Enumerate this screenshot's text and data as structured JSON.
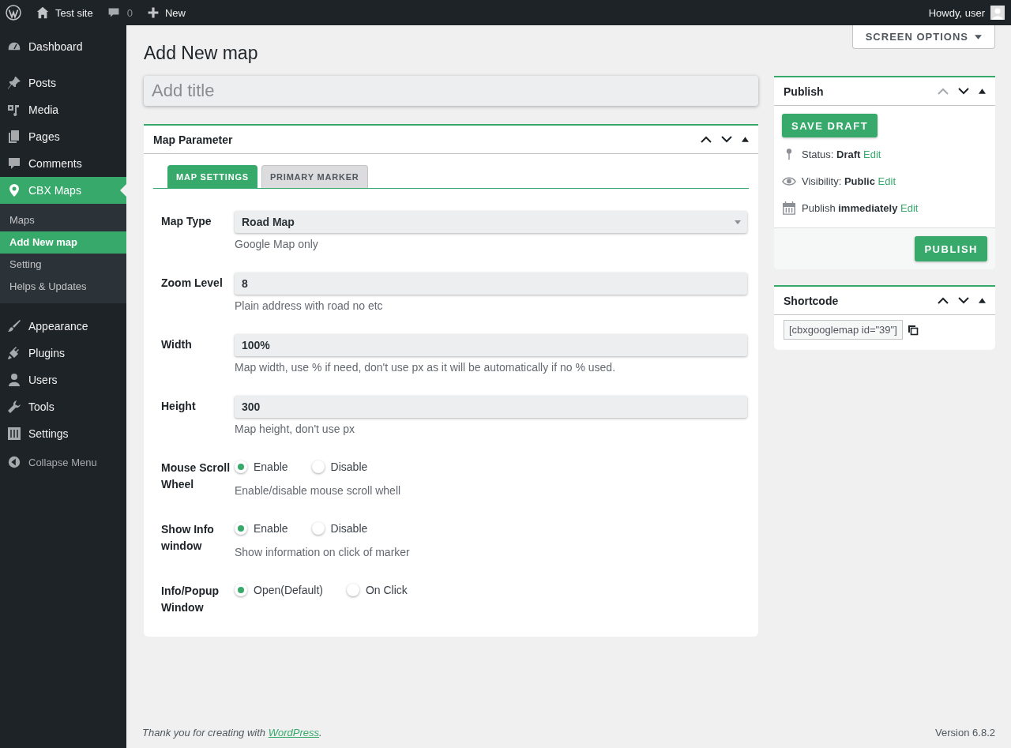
{
  "admin_bar": {
    "site_name": "Test site",
    "comments_count": "0",
    "new_label": "New",
    "greeting": "Howdy, user"
  },
  "sidebar": {
    "sections": [
      {
        "items": [
          {
            "label": "Dashboard",
            "selected": false
          }
        ]
      },
      {
        "items": [
          {
            "label": "Posts",
            "selected": false
          },
          {
            "label": "Media",
            "selected": false
          },
          {
            "label": "Pages",
            "selected": false
          },
          {
            "label": "Comments",
            "selected": false
          },
          {
            "label": "CBX Maps",
            "selected": true,
            "children": [
              {
                "label": "Maps",
                "selected": false
              },
              {
                "label": "Add New map",
                "selected": true
              },
              {
                "label": "Setting",
                "selected": false
              },
              {
                "label": "Helps & Updates",
                "selected": false
              }
            ]
          }
        ]
      },
      {
        "items": [
          {
            "label": "Appearance",
            "selected": false
          },
          {
            "label": "Plugins",
            "selected": false
          },
          {
            "label": "Users",
            "selected": false
          },
          {
            "label": "Tools",
            "selected": false
          },
          {
            "label": "Settings",
            "selected": false
          }
        ]
      }
    ],
    "collapse_label": "Collapse Menu"
  },
  "screen_options": "SCREEN OPTIONS",
  "page_title": "Add New map",
  "title_field": {
    "placeholder": "Add title"
  },
  "map_parameter": {
    "title": "Map Parameter",
    "move_up_disabled": false,
    "tabs": [
      {
        "label": "MAP SETTINGS",
        "selected": true
      },
      {
        "label": "PRIMARY MARKER",
        "selected": false
      }
    ],
    "fields": [
      {
        "kind": "select",
        "label": "Map Type",
        "value": "Road Map",
        "description": "Google Map only"
      },
      {
        "kind": "text",
        "label": "Zoom Level",
        "value": "8",
        "description": "Plain address with road no etc"
      },
      {
        "kind": "text",
        "label": "Width",
        "value": "100%",
        "description": "Map width, use % if need, don't use px as it will be automatically if no % used."
      },
      {
        "kind": "text",
        "label": "Height",
        "value": "300",
        "description": "Map height, don't use px"
      },
      {
        "kind": "radio",
        "label": "Mouse Scroll Wheel",
        "options": [
          {
            "label": "Enable",
            "selected": true
          },
          {
            "label": "Disable",
            "selected": false
          }
        ],
        "description": "Enable/disable mouse scroll whell"
      },
      {
        "kind": "radio",
        "label": "Show Info window",
        "options": [
          {
            "label": "Enable",
            "selected": true
          },
          {
            "label": "Disable",
            "selected": false
          }
        ],
        "description": "Show information on click of marker"
      },
      {
        "kind": "radio",
        "label": "Info/Popup Window",
        "options": [
          {
            "label": "Open(Default)",
            "selected": true
          },
          {
            "label": "On Click",
            "selected": false
          }
        ]
      }
    ]
  },
  "publish": {
    "title": "Publish",
    "move_up_disabled": true,
    "save_draft": "SAVE DRAFT",
    "rows": [
      {
        "kind": "status",
        "text": "Status: **Draft**",
        "edit": "Edit"
      },
      {
        "kind": "visibility",
        "text": "Visibility: **Public**",
        "edit": "Edit"
      },
      {
        "kind": "schedule",
        "text": "Publish **immediately**",
        "edit": "Edit"
      }
    ],
    "publish_button": "PUBLISH"
  },
  "shortcode": {
    "title": "Shortcode",
    "move_up_disabled": false,
    "value": "[cbxgooglemap id=\"39\"]"
  },
  "footer": {
    "thanks_before": "Thank you for creating with ",
    "thanks_link": "WordPress",
    "thanks_after": ".",
    "version": "Version 6.8.2"
  }
}
